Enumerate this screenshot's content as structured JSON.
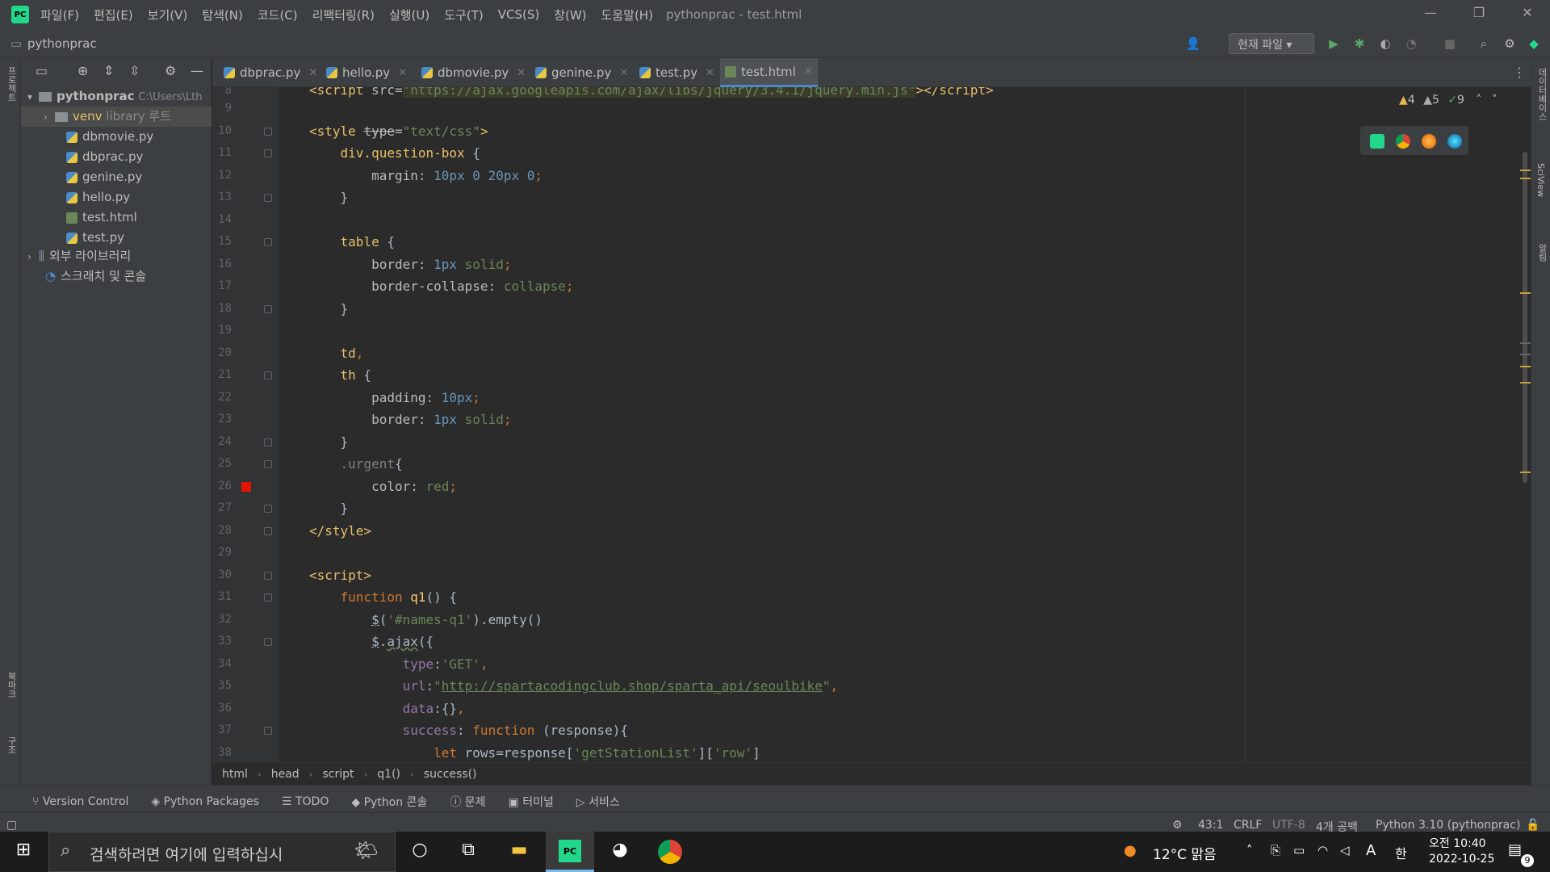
{
  "titlebar": {
    "menu": [
      "파일(F)",
      "편집(E)",
      "보기(V)",
      "탐색(N)",
      "코드(C)",
      "리팩터링(R)",
      "실행(U)",
      "도구(T)",
      "VCS(S)",
      "창(W)",
      "도움말(H)"
    ],
    "title": "pythonprac - test.html"
  },
  "navbar": {
    "project": "pythonprac",
    "run_config": "현재 파일"
  },
  "left_strip": {
    "project_label": "프로젝트",
    "bookmarks_label": "북마크",
    "structure_label": "구조"
  },
  "right_strip": {
    "database_label": "데이터베이스",
    "sciview_label": "SciView",
    "notifications_label": "알림"
  },
  "project_panel": {
    "root": "pythonprac",
    "root_path": "C:\\Users\\Lth",
    "venv": "venv",
    "venv_note": "library 루트",
    "files": [
      "dbmovie.py",
      "dbprac.py",
      "genine.py",
      "hello.py",
      "test.html",
      "test.py"
    ],
    "external_libs": "외부 라이브러리",
    "scratches": "스크래치 및 콘솔"
  },
  "tabs": [
    "dbprac.py",
    "hello.py",
    "dbmovie.py",
    "genine.py",
    "test.py",
    "test.html"
  ],
  "active_tab": "test.html",
  "inspections": {
    "warnings": "4",
    "weak_warnings": "5",
    "ok": "9"
  },
  "breadcrumb": [
    "html",
    "head",
    "script",
    "q1()",
    "success()"
  ],
  "tool_windows": [
    "Version Control",
    "Python Packages",
    "TODO",
    "Python 콘솔",
    "문제",
    "터미널",
    "서비스"
  ],
  "status": {
    "position": "43:1",
    "line_sep": "CRLF",
    "encoding": "UTF-8",
    "indent": "4개 공백",
    "interpreter": "Python 3.10 (pythonprac)"
  },
  "taskbar": {
    "search_placeholder": "검색하려면 여기에 입력하십시",
    "weather": "12°C  맑음",
    "ime": "한",
    "time": "오전 10:40",
    "date": "2022-10-25",
    "notif_count": "9"
  },
  "colors": {
    "accent": "#4a88c7",
    "breakpoint": "#e51400"
  }
}
